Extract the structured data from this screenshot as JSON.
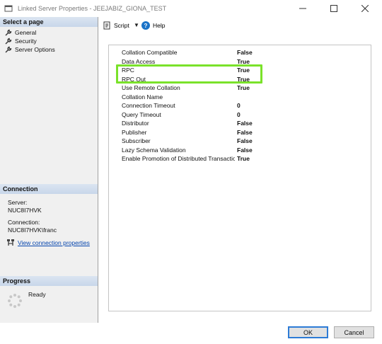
{
  "window": {
    "title": "Linked Server Properties - JEEJABIZ_GIONA_TEST",
    "minimize_icon": "minimize-icon",
    "maximize_icon": "maximize-icon",
    "close_icon": "close-icon"
  },
  "left_pane": {
    "select_page_header": "Select a page",
    "pages": [
      {
        "label": "General",
        "icon": "wrench-icon"
      },
      {
        "label": "Security",
        "icon": "wrench-icon"
      },
      {
        "label": "Server Options",
        "icon": "wrench-icon"
      }
    ],
    "connection": {
      "header": "Connection",
      "server_label": "Server:",
      "server_value": "NUC8I7HVK",
      "connection_label": "Connection:",
      "connection_value": "NUC8I7HVK\\franc",
      "view_link": "View connection properties"
    },
    "progress": {
      "header": "Progress",
      "status": "Ready"
    }
  },
  "toolbar": {
    "script_label": "Script",
    "help_label": "Help"
  },
  "options": [
    {
      "name": "Collation Compatible",
      "value": "False"
    },
    {
      "name": "Data Access",
      "value": "True"
    },
    {
      "name": "RPC",
      "value": "True"
    },
    {
      "name": "RPC Out",
      "value": "True"
    },
    {
      "name": "Use Remote Collation",
      "value": "True"
    },
    {
      "name": "Collation Name",
      "value": ""
    },
    {
      "name": "Connection Timeout",
      "value": "0"
    },
    {
      "name": "Query Timeout",
      "value": "0"
    },
    {
      "name": "Distributor",
      "value": "False"
    },
    {
      "name": "Publisher",
      "value": "False"
    },
    {
      "name": "Subscriber",
      "value": "False"
    },
    {
      "name": "Lazy Schema Validation",
      "value": "False"
    },
    {
      "name": "Enable Promotion of Distributed Transaction",
      "value": "True"
    }
  ],
  "buttons": {
    "ok": "OK",
    "cancel": "Cancel"
  },
  "colors": {
    "highlight": "#7ae22a",
    "link": "#0645ad",
    "header_bg": "#c8d7ea"
  }
}
